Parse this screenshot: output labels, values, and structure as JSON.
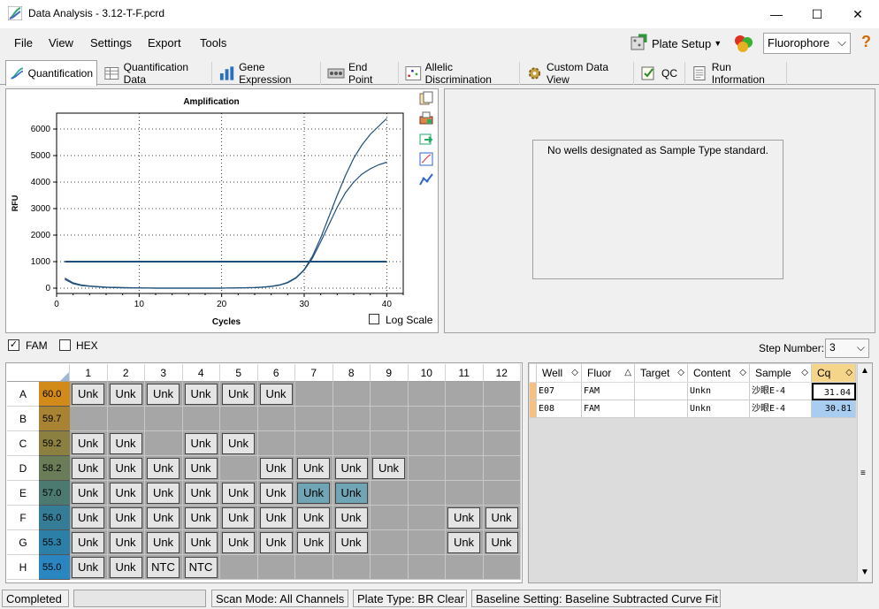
{
  "window": {
    "title": "Data Analysis - 3.12-T-F.pcrd",
    "minimize_glyph": "—",
    "maximize_glyph": "☐",
    "close_glyph": "✕"
  },
  "menu": {
    "file": "File",
    "view": "View",
    "settings": "Settings",
    "export": "Export",
    "tools": "Tools"
  },
  "toolbar": {
    "plate_setup": "Plate Setup",
    "fluorophore": "Fluorophore",
    "help_glyph": "?"
  },
  "tabs": [
    "Quantification",
    "Quantification Data",
    "Gene Expression",
    "End Point",
    "Allelic Discrimination",
    "Custom Data View",
    "QC",
    "Run Information"
  ],
  "chart_data": {
    "type": "line",
    "title": "Amplification",
    "xlabel": "Cycles",
    "ylabel": "RFU",
    "xlim": [
      0,
      42
    ],
    "ylim": [
      -200,
      6600
    ],
    "xticks": [
      0,
      10,
      20,
      30,
      40
    ],
    "yticks": [
      0,
      1000,
      2000,
      3000,
      4000,
      5000,
      6000
    ],
    "threshold": 1000,
    "grid": true,
    "series": [
      {
        "x": [
          1,
          2,
          3,
          4,
          5,
          6,
          8,
          10,
          12,
          15,
          18,
          20,
          22,
          24,
          25,
          26,
          27,
          28,
          29,
          30,
          31,
          32,
          33,
          34,
          35,
          36,
          37,
          38,
          39,
          40
        ],
        "y": [
          380,
          200,
          120,
          80,
          60,
          40,
          20,
          10,
          0,
          0,
          0,
          0,
          10,
          20,
          40,
          70,
          120,
          220,
          400,
          700,
          1200,
          1900,
          2700,
          3500,
          4250,
          4900,
          5400,
          5800,
          6100,
          6400
        ]
      },
      {
        "x": [
          1,
          2,
          3,
          4,
          5,
          6,
          8,
          10,
          12,
          15,
          18,
          20,
          22,
          24,
          25,
          26,
          27,
          28,
          29,
          30,
          31,
          32,
          33,
          34,
          35,
          36,
          37,
          38,
          39,
          40
        ],
        "y": [
          330,
          170,
          100,
          70,
          50,
          30,
          15,
          5,
          0,
          0,
          0,
          0,
          10,
          20,
          35,
          60,
          110,
          200,
          380,
          680,
          1130,
          1750,
          2400,
          3050,
          3600,
          4000,
          4300,
          4500,
          4650,
          4750
        ]
      }
    ]
  },
  "log_scale_label": "Log Scale",
  "standard_message": "No wells designated as Sample Type standard.",
  "fluors": [
    {
      "label": "FAM",
      "checked": "✓"
    },
    {
      "label": "HEX",
      "checked": ""
    }
  ],
  "step": {
    "label": "Step Number:",
    "value": "3",
    "arrow": "⌵"
  },
  "plate": {
    "cols": [
      "1",
      "2",
      "3",
      "4",
      "5",
      "6",
      "7",
      "8",
      "9",
      "10",
      "11",
      "12"
    ],
    "rows": [
      {
        "label": "A",
        "temp": "60.0",
        "color": "#d28a18",
        "cells": [
          "Unk",
          "Unk",
          "Unk",
          "Unk",
          "Unk",
          "Unk",
          "",
          "",
          "",
          "",
          "",
          ""
        ]
      },
      {
        "label": "B",
        "temp": "59.7",
        "color": "#a88432",
        "cells": [
          "",
          "",
          "",
          "",
          "",
          "",
          "",
          "",
          "",
          "",
          "",
          ""
        ]
      },
      {
        "label": "C",
        "temp": "59.2",
        "color": "#8c8040",
        "cells": [
          "Unk",
          "Unk",
          "",
          "Unk",
          "Unk",
          "",
          "",
          "",
          "",
          "",
          "",
          ""
        ]
      },
      {
        "label": "D",
        "temp": "58.2",
        "color": "#6a7c58",
        "cells": [
          "Unk",
          "Unk",
          "Unk",
          "Unk",
          "",
          "Unk",
          "Unk",
          "Unk",
          "Unk",
          "",
          "",
          ""
        ]
      },
      {
        "label": "E",
        "temp": "57.0",
        "color": "#4c7a70",
        "cells": [
          "Unk",
          "Unk",
          "Unk",
          "Unk",
          "Unk",
          "Unk",
          "Unk*",
          "Unk*",
          "",
          "",
          "",
          ""
        ]
      },
      {
        "label": "F",
        "temp": "56.0",
        "color": "#357c96",
        "cells": [
          "Unk",
          "Unk",
          "Unk",
          "Unk",
          "Unk",
          "Unk",
          "Unk",
          "Unk",
          "",
          "",
          "Unk",
          "Unk"
        ]
      },
      {
        "label": "G",
        "temp": "55.3",
        "color": "#2c80a8",
        "cells": [
          "Unk",
          "Unk",
          "Unk",
          "Unk",
          "Unk",
          "Unk",
          "Unk",
          "Unk",
          "",
          "",
          "Unk",
          "Unk"
        ]
      },
      {
        "label": "H",
        "temp": "55.0",
        "color": "#2a86c0",
        "cells": [
          "Unk",
          "Unk",
          "NTC",
          "NTC",
          "",
          "",
          "",
          "",
          "",
          "",
          "",
          ""
        ]
      }
    ]
  },
  "table": {
    "headers": [
      "Well",
      "Fluor",
      "Target",
      "Content",
      "Sample",
      "Cq"
    ],
    "sort_glyphs": [
      "◇",
      "◇",
      "△",
      "◇",
      "◇",
      "◇",
      "◇"
    ],
    "rows": [
      {
        "well": "E07",
        "fluor": "FAM",
        "target": "",
        "content": "Unkn",
        "sample": "沙眼E-4",
        "cq": "31.04"
      },
      {
        "well": "E08",
        "fluor": "FAM",
        "target": "",
        "content": "Unkn",
        "sample": "沙眼E-4",
        "cq": "30.81"
      }
    ]
  },
  "status": {
    "state": "Completed",
    "scan_mode": "Scan Mode: All Channels",
    "plate_type": "Plate Type: BR Clear",
    "baseline": "Baseline Setting: Baseline Subtracted Curve Fit"
  }
}
